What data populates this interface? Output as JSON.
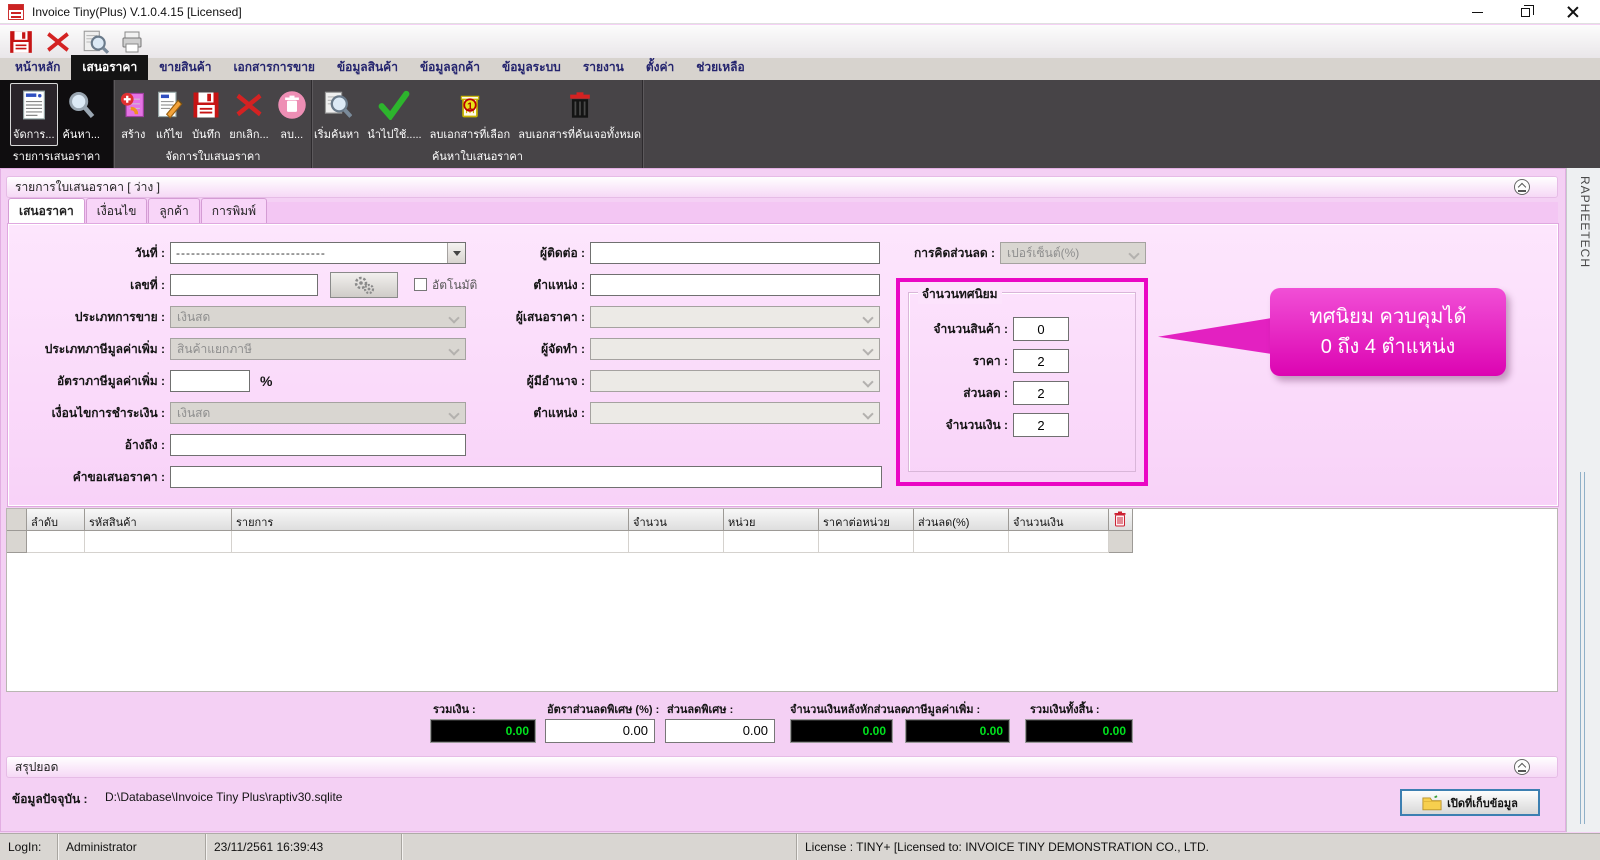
{
  "window": {
    "title": "Invoice Tiny(Plus)  V.1.0.4.15 [Licensed]"
  },
  "menu": {
    "tabs": [
      "หน้าหลัก",
      "เสนอราคา",
      "ขายสินค้า",
      "เอกสารการขาย",
      "ข้อมูลสินค้า",
      "ข้อมูลลูกค้า",
      "ข้อมูลระบบ",
      "รายงาน",
      "ตั้งค่า",
      "ช่วยเหลือ"
    ],
    "active": "เสนอราคา"
  },
  "ribbon": {
    "groups": [
      {
        "label": "รายการเสนอราคา",
        "buttons": [
          {
            "label": "จัดการ...",
            "icon": "manage-quotes"
          },
          {
            "label": "ค้นหา...",
            "icon": "search"
          }
        ]
      },
      {
        "label": "จัดการใบเสนอราคา",
        "buttons": [
          {
            "label": "สร้าง",
            "icon": "create"
          },
          {
            "label": "แก้ไข",
            "icon": "edit"
          },
          {
            "label": "บันทึก",
            "icon": "save"
          },
          {
            "label": "ยกเลิก...",
            "icon": "cancel"
          },
          {
            "label": "ลบ...",
            "icon": "delete"
          }
        ]
      },
      {
        "label": "ค้นหาใบเสนอราคา",
        "buttons": [
          {
            "label": "เริ่มค้นหา",
            "icon": "start-search"
          },
          {
            "label": "นำไปใช้.....",
            "icon": "apply-check"
          },
          {
            "label": "ลบเอกสารที่เลือก",
            "icon": "delete-selected",
            "badge": "1"
          },
          {
            "label": "ลบเอกสารที่ค้นเจอทั้งหมด",
            "icon": "delete-all-found"
          }
        ]
      }
    ]
  },
  "panel": {
    "header": "รายการใบเสนอราคา [  ว่าง ]",
    "tabs": [
      "เสนอราคา",
      "เงื่อนไข",
      "ลูกค้า",
      "การพิมพ์"
    ]
  },
  "form": {
    "date_label": "วันที่ :",
    "date_value": "------------------------------",
    "number_label": "เลขที่ :",
    "auto_label": "อัตโนมัติ",
    "sale_type_label": "ประเภทการขาย :",
    "sale_type_value": "เงินสด",
    "vat_type_label": "ประเภทภาษีมูลค่าเพิ่ม :",
    "vat_type_value": "สินค้าแยกภาษี",
    "vat_rate_label": "อัตราภาษีมูลค่าเพิ่ม :",
    "vat_rate_suffix": "%",
    "payment_label": "เงื่อนไขการชำระเงิน :",
    "payment_value": "เงินสด",
    "reference_label": "อ้างถึง :",
    "request_label": "คำขอเสนอราคา :",
    "contact_label": "ผู้ติดต่อ :",
    "position1_label": "ตำแหน่ง :",
    "quoter_label": "ผู้เสนอราคา :",
    "preparer_label": "ผู้จัดทำ :",
    "authorizer_label": "ผู้มีอำนาจ :",
    "position2_label": "ตำแหน่ง :",
    "discount_label": "การคิดส่วนลด :",
    "discount_value": "เปอร์เซ็นต์(%)"
  },
  "decimal_box": {
    "legend": "จำนวนทศนิยม",
    "fields": [
      {
        "label": "จำนวนสินค้า :",
        "value": "0"
      },
      {
        "label": "ราคา :",
        "value": "2"
      },
      {
        "label": "ส่วนลด :",
        "value": "2"
      },
      {
        "label": "จำนวนเงิน :",
        "value": "2"
      }
    ]
  },
  "callout": {
    "line1": "ทศนิยม ควบคุมได้",
    "line2": "0 ถึง 4 ตำแหน่ง"
  },
  "grid": {
    "columns": [
      "ลำดับ",
      "รหัสสินค้า",
      "รายการ",
      "จำนวน",
      "หน่วย",
      "ราคาต่อหน่วย",
      "ส่วนลด(%)",
      "จำนวนเงิน"
    ]
  },
  "totals": [
    {
      "label": "รวมเงิน :",
      "value": "0.00"
    },
    {
      "label": "อัตราส่วนลดพิเศษ (%) :",
      "value": "0.00"
    },
    {
      "label": "ส่วนลดพิเศษ :",
      "value": "0.00"
    },
    {
      "label": "จำนวนเงินหลังหักส่วนลด :",
      "value": "0.00"
    },
    {
      "label": "ภาษีมูลค่าเพิ่ม :",
      "value": "0.00"
    },
    {
      "label": "รวมเงินทั้งสิ้น :",
      "value": "0.00"
    }
  ],
  "summary": {
    "label": "สรุปยอด"
  },
  "datafile": {
    "label": "ข้อมูลปัจจุบัน :",
    "path": "D:\\Database\\Invoice Tiny Plus\\raptiv30.sqlite",
    "open_button": "เปิดที่เก็บข้อมูล"
  },
  "status": {
    "login_label": "LogIn:",
    "user": "Administrator",
    "datetime": "23/11/2561 16:39:43",
    "license": "License : TINY+ [Licensed to: INVOICE TINY DEMONSTRATION CO., LTD."
  },
  "side_strip": {
    "text": "RAPHEETECH"
  },
  "colors": {
    "highlight": "#ea07c4",
    "callout": "#e321c1",
    "total_text": "#00e21e",
    "ribbon_bg": "#474447"
  }
}
